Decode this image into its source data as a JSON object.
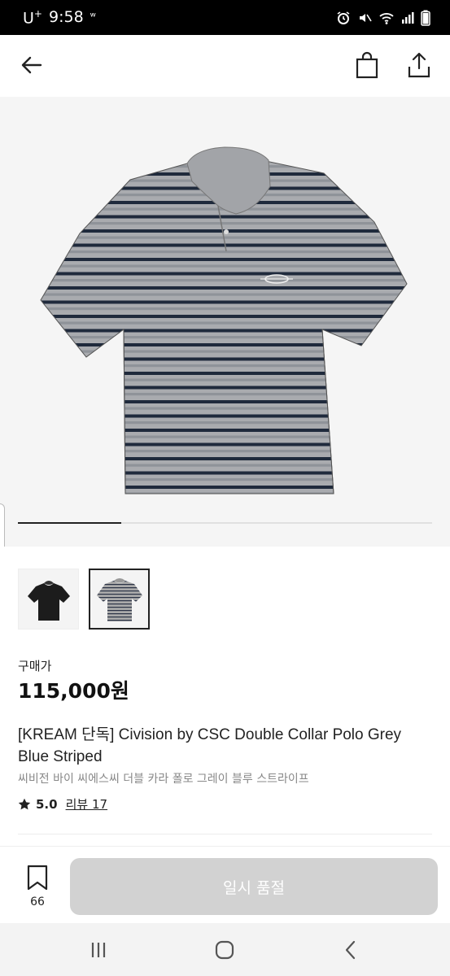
{
  "status_bar": {
    "carrier": "U",
    "carrier_sup": "+",
    "time": "9:58",
    "signal_text": "ʷ"
  },
  "header": {
    "icons": [
      "back-arrow-icon",
      "shopping-bag-icon",
      "share-icon"
    ]
  },
  "product": {
    "image_index_fraction": 0.25,
    "thumbnails": [
      "black-polo-thumbnail",
      "grey-striped-polo-thumbnail"
    ],
    "selected_thumbnail": 1,
    "price_label": "구매가",
    "price": "115,000원",
    "title_en": "[KREAM 단독] Civision by CSC Double Collar Polo Grey Blue Striped",
    "title_ko": "씨비전 바이 씨에스씨 더블 카라 폴로 그레이 블루 스트라이프",
    "rating": "5.0",
    "reviews": "리뷰 17"
  },
  "action_bar": {
    "wish_count": "66",
    "soldout_label": "일시 품절"
  },
  "colors": {
    "soldout_button": "#d2d2d2",
    "stripe_navy": "#1f2a3c",
    "stripe_grey": "#a8aaae"
  }
}
